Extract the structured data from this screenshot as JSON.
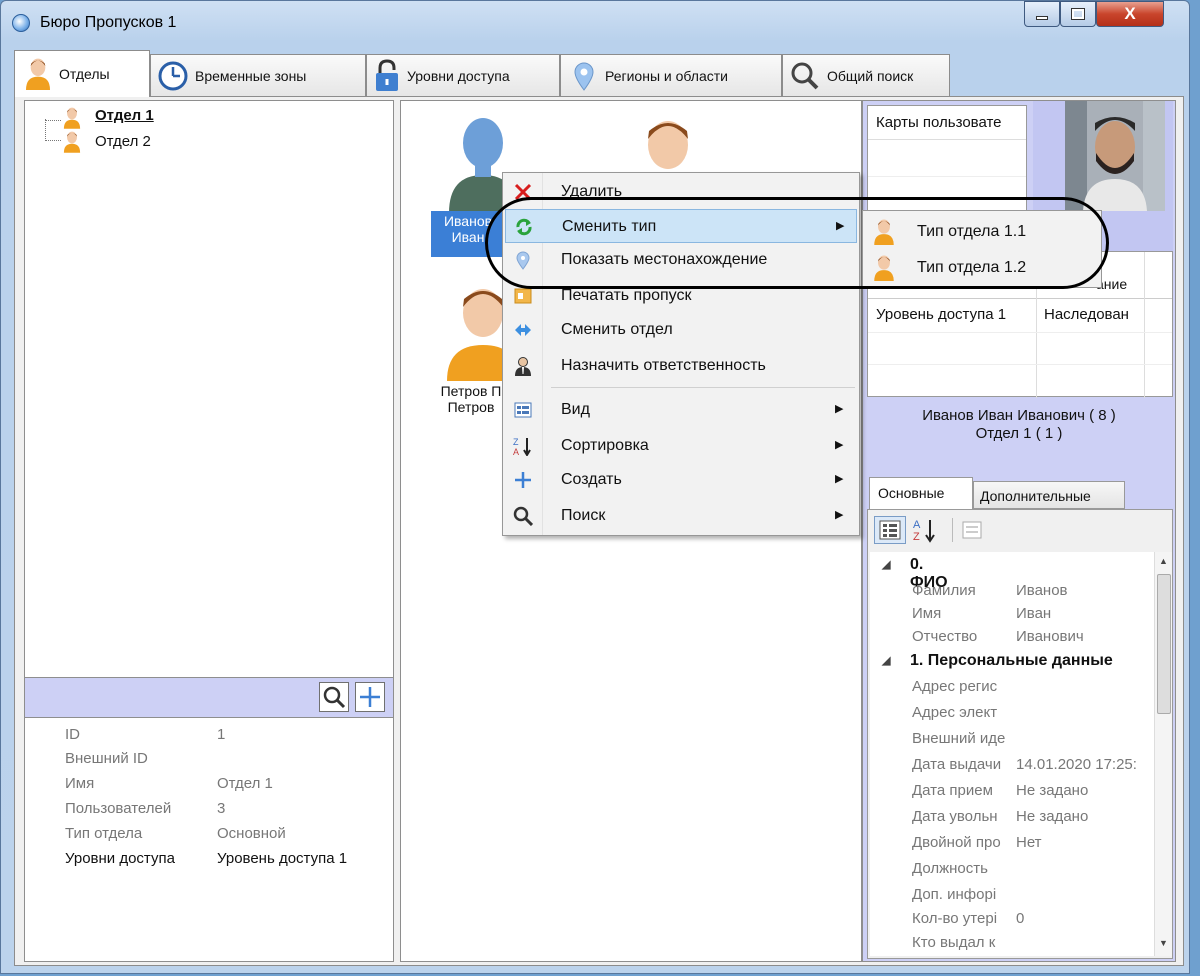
{
  "window": {
    "title": "Бюро Пропусков 1"
  },
  "tabs": [
    {
      "label": "Отделы"
    },
    {
      "label": "Временные зоны"
    },
    {
      "label": "Уровни доступа"
    },
    {
      "label": "Регионы и области"
    },
    {
      "label": "Общий поиск"
    }
  ],
  "tree": {
    "items": [
      {
        "label": "Отдел 1"
      },
      {
        "label": "Отдел 2"
      }
    ]
  },
  "dept_props": [
    {
      "key": "ID",
      "value": "1"
    },
    {
      "key": "Внешний ID",
      "value": ""
    },
    {
      "key": "Имя",
      "value": "Отдел 1"
    },
    {
      "key": "Пользователей",
      "value": "3"
    },
    {
      "key": "Тип отдела",
      "value": "Основной"
    },
    {
      "key": "Уровни доступа",
      "value": "Уровень доступа 1"
    }
  ],
  "users": [
    {
      "line1": "Иванов",
      "line2": "Иван"
    },
    {
      "line1": "Петров П",
      "line2": "Петров"
    }
  ],
  "context_menu": {
    "items": [
      {
        "label": "Удалить",
        "icon": "delete-icon"
      },
      {
        "label": "Сменить тип",
        "icon": "change-type-icon",
        "submenu": true
      },
      {
        "label": "Показать местонахождение",
        "icon": "location-icon"
      },
      {
        "label": "Печатать пропуск",
        "icon": "print-pass-icon"
      },
      {
        "label": "Сменить отдел",
        "icon": "change-department-icon"
      },
      {
        "label": "Назначить ответственность",
        "icon": "assign-responsibility-icon"
      },
      {
        "label": "Вид",
        "icon": "view-icon",
        "submenu": true
      },
      {
        "label": "Сортировка",
        "icon": "sort-icon",
        "submenu": true
      },
      {
        "label": "Создать",
        "icon": "plus-icon",
        "submenu": true
      },
      {
        "label": "Поиск",
        "icon": "search-icon",
        "submenu": true
      }
    ],
    "submenu": [
      {
        "label": "Тип отдела 1.1"
      },
      {
        "label": "Тип отдела 1.2"
      }
    ]
  },
  "cards": {
    "header": "Карты пользовате"
  },
  "access_grid": {
    "header_fragment": "ание",
    "rows": [
      {
        "level": "Уровень доступа 1",
        "status": "Наследован"
      }
    ]
  },
  "user_summary": {
    "name": "Иванов Иван Иванович ( 8 )",
    "dept": "Отдел 1 ( 1 )"
  },
  "prop_tabs": [
    {
      "label": "Основные"
    },
    {
      "label": "Дополнительные"
    }
  ],
  "property_grid": {
    "groups": [
      {
        "title": "0. ФИО",
        "rows": [
          {
            "key": "Фамилия",
            "value": "Иванов"
          },
          {
            "key": "Имя",
            "value": "Иван"
          },
          {
            "key": "Отчество",
            "value": "Иванович"
          }
        ]
      },
      {
        "title": "1. Персональные данные",
        "rows": [
          {
            "key": "Адрес регис",
            "value": ""
          },
          {
            "key": "Адрес элект",
            "value": ""
          },
          {
            "key": "Внешний иде",
            "value": ""
          },
          {
            "key": "Дата выдачи",
            "value": "14.01.2020 17:25:"
          },
          {
            "key": "Дата прием",
            "value": "Не задано"
          },
          {
            "key": "Дата увольн",
            "value": "Не задано"
          },
          {
            "key": "Двойной про",
            "value": "Нет"
          },
          {
            "key": "Должность",
            "value": ""
          },
          {
            "key": "Доп. инфорі",
            "value": ""
          },
          {
            "key": "Кол-во утері",
            "value": "0"
          },
          {
            "key": "Кто выдал к",
            "value": ""
          }
        ]
      }
    ]
  },
  "colors": {
    "selection": "#3b7fd6",
    "panel_lavender": "#cdd0f5",
    "menu_highlight": "#cce4f7"
  }
}
